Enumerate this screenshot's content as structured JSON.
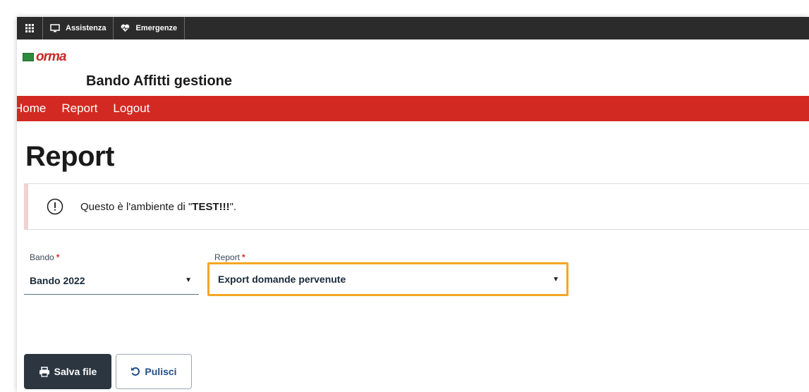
{
  "topbar": {
    "menu_icon": "grid-icon",
    "items": [
      {
        "label": "Assistenza",
        "icon": "monitor-icon"
      },
      {
        "label": "Emergenze",
        "icon": "heart-pulse-icon"
      }
    ]
  },
  "brand": {
    "logo_text": "orma",
    "app_title": "Bando Affitti gestione"
  },
  "nav": {
    "items": [
      "Home",
      "Report",
      "Logout"
    ]
  },
  "page": {
    "title": "Report"
  },
  "alert": {
    "icon": "exclamation-circle-icon",
    "text_prefix": "Questo è l'ambiente di \"",
    "text_bold": "TEST!!!",
    "text_suffix": "\"."
  },
  "form": {
    "bando": {
      "label": "Bando",
      "required_mark": "*",
      "value": "Bando 2022"
    },
    "report": {
      "label": "Report",
      "required_mark": "*",
      "value": "Export domande pervenute"
    }
  },
  "actions": {
    "save_label": "Salva file",
    "clear_label": "Pulisci"
  },
  "colors": {
    "nav_red": "#d22a22",
    "topbar_dark": "#2b2b2b",
    "highlight_orange": "#f5a623",
    "save_button": "#2b3640"
  }
}
